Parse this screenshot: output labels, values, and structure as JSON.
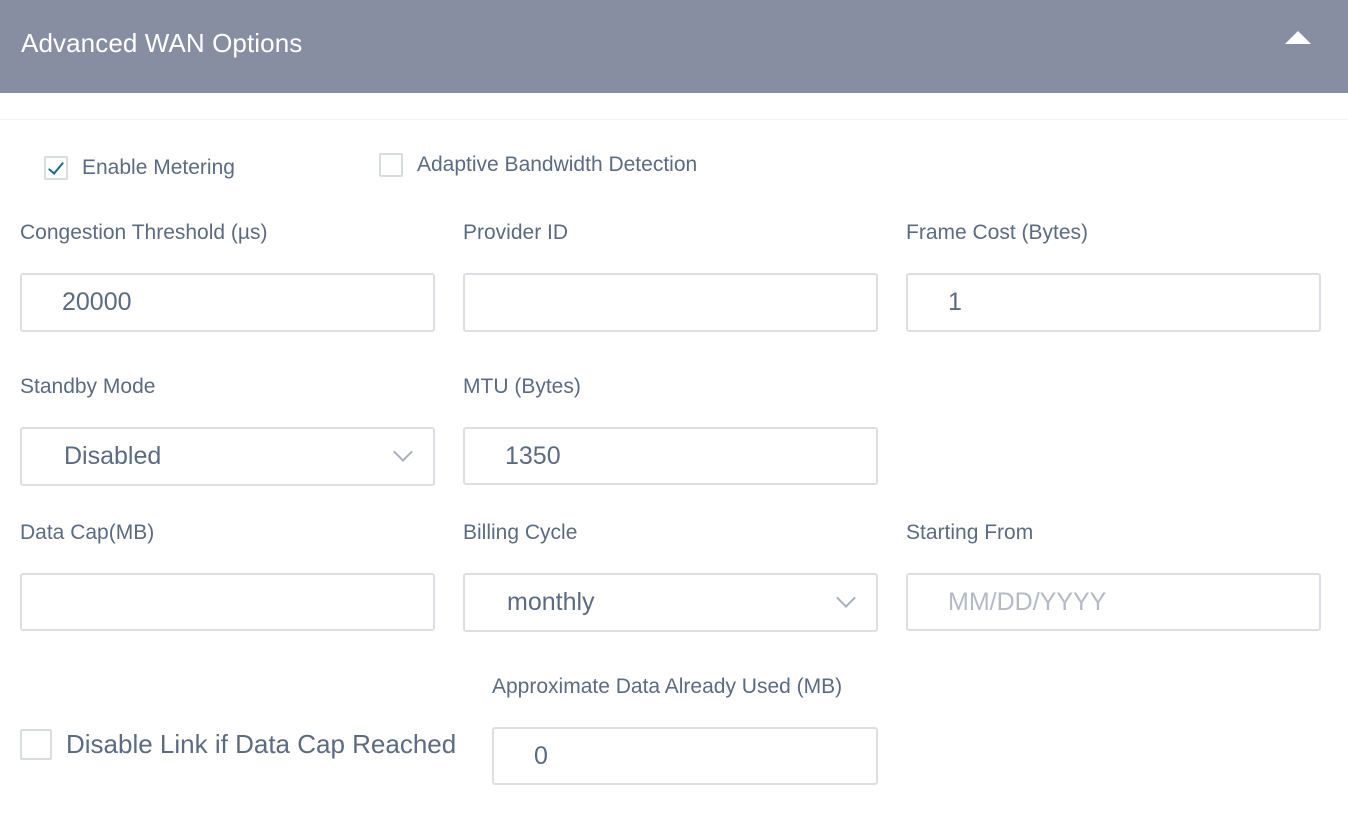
{
  "header": {
    "title": "Advanced WAN Options",
    "collapse_icon": "caret-up-icon",
    "color": "#888ea1"
  },
  "checkboxes": {
    "enable_metering": {
      "label": "Enable Metering",
      "checked": true
    },
    "adaptive_bandwidth": {
      "label": "Adaptive Bandwidth Detection",
      "checked": false
    },
    "disable_link": {
      "label": "Disable Link if Data Cap Reached",
      "checked": false
    }
  },
  "fields": {
    "congestion_threshold": {
      "label": "Congestion Threshold (µs)",
      "value": "20000"
    },
    "provider_id": {
      "label": "Provider ID",
      "value": ""
    },
    "frame_cost": {
      "label": "Frame Cost (Bytes)",
      "value": "1"
    },
    "standby_mode": {
      "label": "Standby Mode",
      "value": "Disabled"
    },
    "mtu": {
      "label": "MTU (Bytes)",
      "value": "1350"
    },
    "data_cap": {
      "label": "Data Cap(MB)",
      "value": ""
    },
    "billing_cycle": {
      "label": "Billing Cycle",
      "value": "monthly"
    },
    "starting_from": {
      "label": "Starting From",
      "value": "",
      "placeholder": "MM/DD/YYYY"
    },
    "data_used": {
      "label": "Approximate Data Already Used (MB)",
      "value": "0"
    }
  },
  "colors": {
    "check_accent": "#1f6e86",
    "text": "#5b6b82",
    "placeholder": "#b3bac6",
    "border": "#dcdee3"
  }
}
